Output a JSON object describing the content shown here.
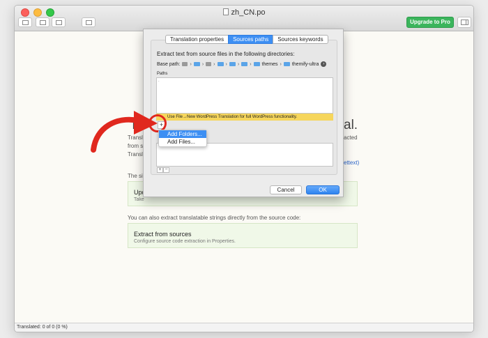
{
  "window": {
    "title": "zh_CN.po",
    "upgrade_label": "Upgrade to Pro"
  },
  "background": {
    "heading_left": "Th",
    "heading_right": "al.",
    "line1_left": "Transl",
    "line1_right": "acted",
    "line2_left": "from s",
    "line3_left": "Transl",
    "link_suffix": "ettext)",
    "simple_prefix": "The si",
    "card1_title": "Upd",
    "card1_sub": "Take",
    "extract_prompt": "You can also extract translatable strings directly from the source code:",
    "card2_title": "Extract from sources",
    "card2_sub": "Configure source code extraction in Properties."
  },
  "status": "Translated: 0 of 0 (0 %)",
  "dialog": {
    "tabs": [
      "Translation properties",
      "Sources paths",
      "Sources keywords"
    ],
    "active_tab": "Sources paths",
    "heading": "Extract text from source files in the following directories:",
    "base_path_label": "Base path:",
    "base_path_segments": [
      "themes",
      "themify-ultra"
    ],
    "paths_label": "Paths",
    "paths_first_row": ".",
    "warning": "Use File→New WordPress Translation for full WordPress functionality.",
    "add_button": "+",
    "menu": [
      "Add Folders...",
      "Add Files..."
    ],
    "minus_button": "−",
    "plus_small": "+",
    "cancel_label": "Cancel",
    "ok_label": "OK"
  },
  "colors": {
    "accent": "#3d8ff3",
    "upgrade_green": "#3bb55c",
    "warning_yellow": "#f6d65c",
    "annotation_red": "#e0281e"
  }
}
